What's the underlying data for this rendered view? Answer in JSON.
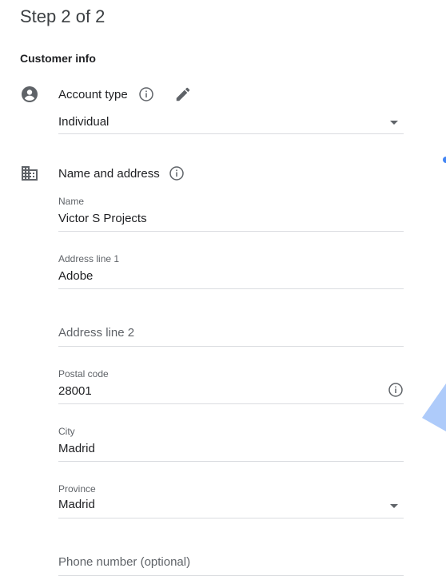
{
  "header": {
    "step_title": "Step 2 of 2",
    "section_title": "Customer info"
  },
  "account_type": {
    "label": "Account type",
    "value": "Individual",
    "icon": "account-circle-icon"
  },
  "name_address": {
    "label": "Name and address",
    "icon": "business-building-icon"
  },
  "fields": {
    "name": {
      "label": "Name",
      "value": "Victor S Projects"
    },
    "address1": {
      "label": "Address line 1",
      "value": "Adobe"
    },
    "address2": {
      "placeholder": "Address line 2"
    },
    "postal_code": {
      "label": "Postal code",
      "value": "28001"
    },
    "city": {
      "label": "City",
      "value": "Madrid"
    },
    "province": {
      "label": "Province",
      "value": "Madrid"
    },
    "phone": {
      "placeholder": "Phone number (optional)"
    }
  },
  "colors": {
    "accent": "#4285f4",
    "icon_gray": "#5f6368",
    "divider": "#dadce0"
  }
}
